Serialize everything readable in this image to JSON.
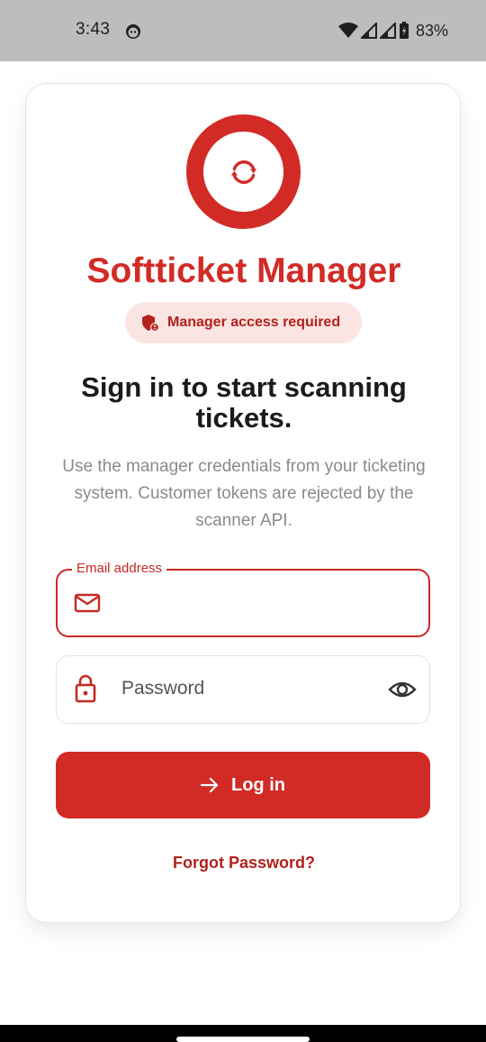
{
  "status_bar": {
    "time": "3:43",
    "battery": "83%",
    "icons": [
      "face-icon",
      "wifi-icon",
      "signal-icon",
      "signal-icon",
      "battery-icon"
    ]
  },
  "app": {
    "title": "Softticket Manager",
    "logo_icon": "sync-icon",
    "accent_color": "#d22b26"
  },
  "badge": {
    "text": "Manager access required",
    "icon": "shield-user-icon"
  },
  "headline": "Sign in to start scanning tickets.",
  "subtext": "Use the manager credentials from your ticketing system. Customer tokens are rejected by the scanner API.",
  "form": {
    "email": {
      "label": "Email address",
      "value": "",
      "icon": "mail-icon"
    },
    "password": {
      "placeholder": "Password",
      "icon": "lock-icon",
      "toggle_icon": "eye-icon"
    },
    "login_button": {
      "label": "Log in",
      "icon": "arrow-right-icon"
    },
    "forgot_link": "Forgot Password?"
  }
}
